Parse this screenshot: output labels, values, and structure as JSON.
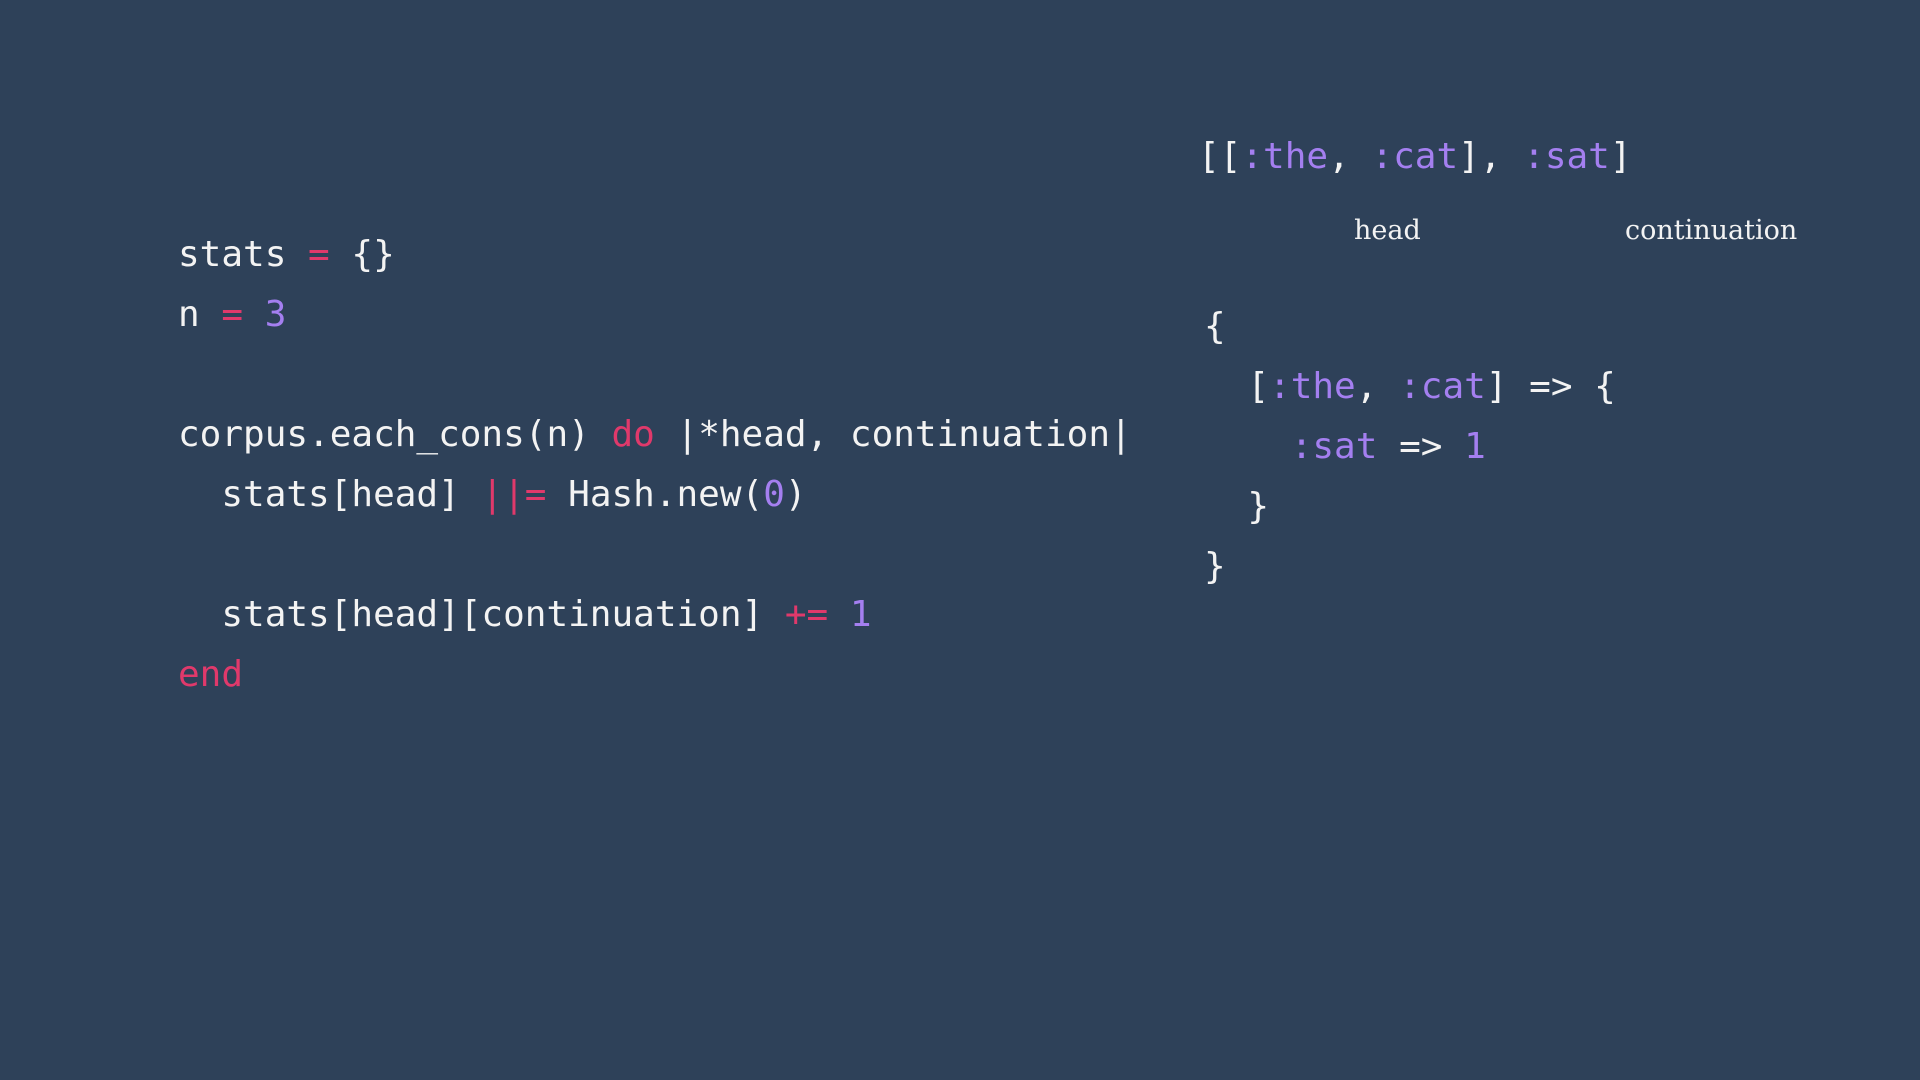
{
  "left_code": {
    "lines": [
      [
        {
          "t": "stats ",
          "c": "plain"
        },
        {
          "t": "=",
          "c": "op"
        },
        {
          "t": " {}",
          "c": "plain"
        }
      ],
      [
        {
          "t": "n ",
          "c": "plain"
        },
        {
          "t": "=",
          "c": "op"
        },
        {
          "t": " ",
          "c": "plain"
        },
        {
          "t": "3",
          "c": "num"
        }
      ],
      [
        {
          "t": "corpus.each_cons(n) ",
          "c": "plain"
        },
        {
          "t": "do",
          "c": "kw"
        },
        {
          "t": " |*head, continuation|",
          "c": "plain"
        }
      ],
      [
        {
          "t": "  stats[head] ",
          "c": "plain"
        },
        {
          "t": "||=",
          "c": "op"
        },
        {
          "t": " Hash.new(",
          "c": "plain"
        },
        {
          "t": "0",
          "c": "num"
        },
        {
          "t": ")",
          "c": "plain"
        }
      ],
      [
        {
          "t": "  stats[head][continuation] ",
          "c": "plain"
        },
        {
          "t": "+=",
          "c": "op"
        },
        {
          "t": " ",
          "c": "plain"
        },
        {
          "t": "1",
          "c": "num"
        }
      ],
      [
        {
          "t": "end",
          "c": "kw"
        }
      ]
    ]
  },
  "right_code": {
    "lines": [
      [
        {
          "t": "[[",
          "c": "plain"
        },
        {
          "t": ":the",
          "c": "sym"
        },
        {
          "t": ", ",
          "c": "plain"
        },
        {
          "t": ":cat",
          "c": "sym"
        },
        {
          "t": "], ",
          "c": "plain"
        },
        {
          "t": ":sat",
          "c": "sym"
        },
        {
          "t": "]",
          "c": "plain"
        }
      ],
      [
        {
          "t": "{",
          "c": "plain"
        }
      ],
      [
        {
          "t": "  [",
          "c": "plain"
        },
        {
          "t": ":the",
          "c": "sym"
        },
        {
          "t": ", ",
          "c": "plain"
        },
        {
          "t": ":cat",
          "c": "sym"
        },
        {
          "t": "] => {",
          "c": "plain"
        }
      ],
      [
        {
          "t": "    ",
          "c": "plain"
        },
        {
          "t": ":sat",
          "c": "sym"
        },
        {
          "t": " => ",
          "c": "plain"
        },
        {
          "t": "1",
          "c": "num"
        }
      ],
      [
        {
          "t": "  }",
          "c": "plain"
        }
      ],
      [
        {
          "t": "}",
          "c": "plain"
        }
      ]
    ]
  },
  "annotations": {
    "head": "head",
    "continuation": "continuation"
  }
}
